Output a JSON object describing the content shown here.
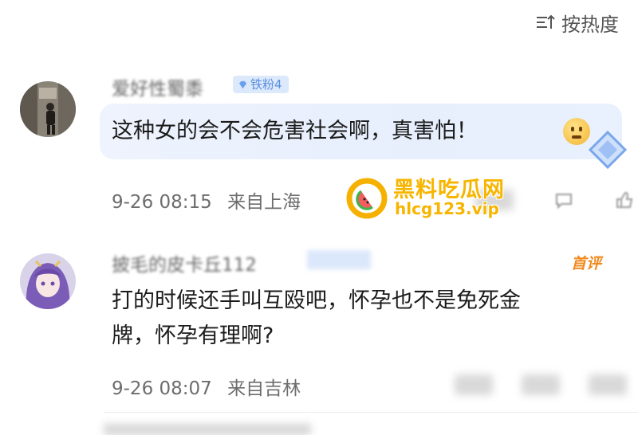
{
  "sort": {
    "label": "按热度",
    "icon": "sort-icon"
  },
  "comments": [
    {
      "username": "爱好性蜀黍",
      "badge": "铁粉4",
      "text": "这种女的会不会危害社会啊，真害怕！",
      "emoji": "thinking-face",
      "sticker": "diamond-sticker",
      "time": "9-26 08:15",
      "location": "来自上海"
    },
    {
      "username": "披毛的皮卡丘112",
      "tag": "首评",
      "text": "打的时候还手叫互殴吧，怀孕也不是免死金\n牌，怀孕有理啊?",
      "time": "9-26 08:07",
      "location": "来自吉林"
    }
  ],
  "watermark": {
    "title": "黑料吃瓜网",
    "url": "hlcg123.vip"
  },
  "colors": {
    "badge_bg": "#dce9fb",
    "badge_text": "#5b8fdf",
    "watermark": "#f7b500",
    "first_tag": "#f08a1e",
    "bubble": "#e9f0fd"
  }
}
